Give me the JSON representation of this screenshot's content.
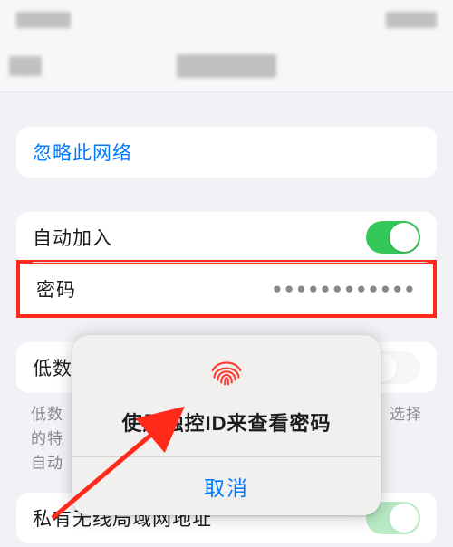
{
  "forget_network": {
    "label": "忽略此网络"
  },
  "auto_join": {
    "label": "自动加入",
    "on": true
  },
  "password": {
    "label": "密码",
    "masked_value": "●●●●●●●●●●●●"
  },
  "low_data": {
    "label_partial": "低数",
    "on": false
  },
  "footnote": {
    "line1_left": "低数",
    "line1_right": "选择",
    "line2_left": "的特",
    "line3_left": "自动"
  },
  "private_address": {
    "label_partial": "私有无线局域网地址"
  },
  "modal": {
    "title": "使用触控ID来查看密码",
    "cancel": "取消"
  }
}
